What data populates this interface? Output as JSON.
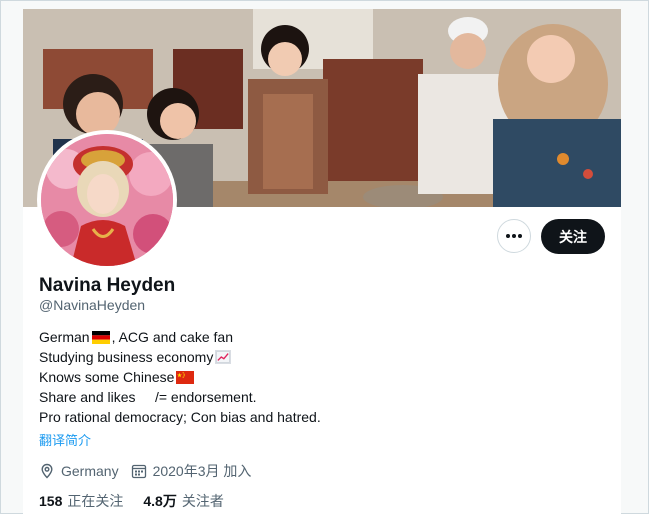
{
  "profile": {
    "display_name": "Navina Heyden",
    "handle": "@NavinaHeyden",
    "bio_lines": [
      {
        "text_before": "German ",
        "flag": "germany-flag-icon",
        "text_after": ", ACG and cake fan"
      },
      {
        "text_before": "Studying business economy",
        "icon": "chart-increasing-icon",
        "text_after": ""
      },
      {
        "text_before": "Knows some Chinese ",
        "flag": "china-flag-icon",
        "text_after": ""
      },
      {
        "text_before": "Share and likes     /= endorsement.",
        "text_after": ""
      },
      {
        "text_before": "Pro rational democracy; Con bias and hatred.",
        "text_after": ""
      }
    ],
    "translate_link": "翻译简介",
    "location": "Germany",
    "joined": "2020年3月 加入",
    "following_count": "158",
    "following_label": "正在关注",
    "followers_count": "4.8万",
    "followers_label": "关注者"
  },
  "actions": {
    "more_icon": "more-icon",
    "follow_label": "关注"
  },
  "colors": {
    "follow_bg": "#0f1419",
    "link": "#1d9bf0",
    "secondary_text": "#536471"
  }
}
